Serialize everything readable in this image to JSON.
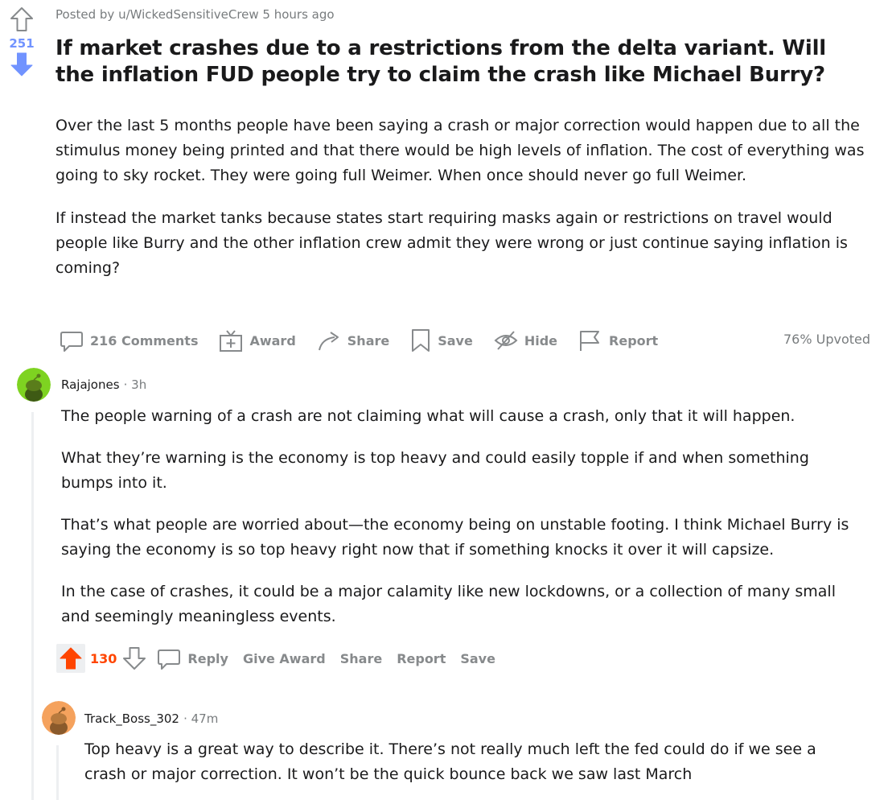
{
  "post": {
    "score": "251",
    "meta": "Posted by u/WickedSensitiveCrew 5 hours ago",
    "title": "If market crashes due to a restrictions from the delta variant. Will the inflation FUD people try to claim the crash like Michael Burry?",
    "paragraphs": [
      "Over the last 5 months people have been saying a crash or major correction would happen due to all the stimulus money being printed and that there would be high levels of inflation. The cost of everything was going to sky rocket. They were going full Weimer. When once should never go full Weimer.",
      "If instead the market tanks because states start requiring masks again or restrictions on travel would people like Burry and the other inflation crew admit they were wrong or just continue saying inflation is coming?"
    ],
    "actions": {
      "comments": "216 Comments",
      "award": "Award",
      "share": "Share",
      "save": "Save",
      "hide": "Hide",
      "report": "Report"
    },
    "upvoted": "76% Upvoted"
  },
  "comments": [
    {
      "author": "Rajajones",
      "time": "· 3h",
      "paragraphs": [
        "The people warning of a crash are not claiming what will cause a crash, only that it will happen.",
        "What they’re warning is the economy is top heavy and could easily topple if and when something bumps into it.",
        "That’s what people are worried about—the economy being on unstable footing. I think Michael Burry is saying the economy is so top heavy right now that if something knocks it over it will capsize.",
        "In the case of crashes, it could be a major calamity like new lockdowns, or a collection of many small and seemingly meaningless events."
      ],
      "score": "130",
      "actions": {
        "reply": "Reply",
        "give_award": "Give Award",
        "share": "Share",
        "report": "Report",
        "save": "Save"
      },
      "avatar_color": "#7ed321"
    },
    {
      "author": "Track_Boss_302",
      "time": "· 47m",
      "paragraphs": [
        "Top heavy is a great way to describe it. There’s not really much left the fed could do if we see a crash or major correction. It won’t be the quick bounce back we saw last March"
      ],
      "avatar_color": "#f5a25d"
    }
  ],
  "colors": {
    "downvote_blue": "#7193ff",
    "upvote_orange": "#ff4500",
    "muted": "#878a8c"
  }
}
